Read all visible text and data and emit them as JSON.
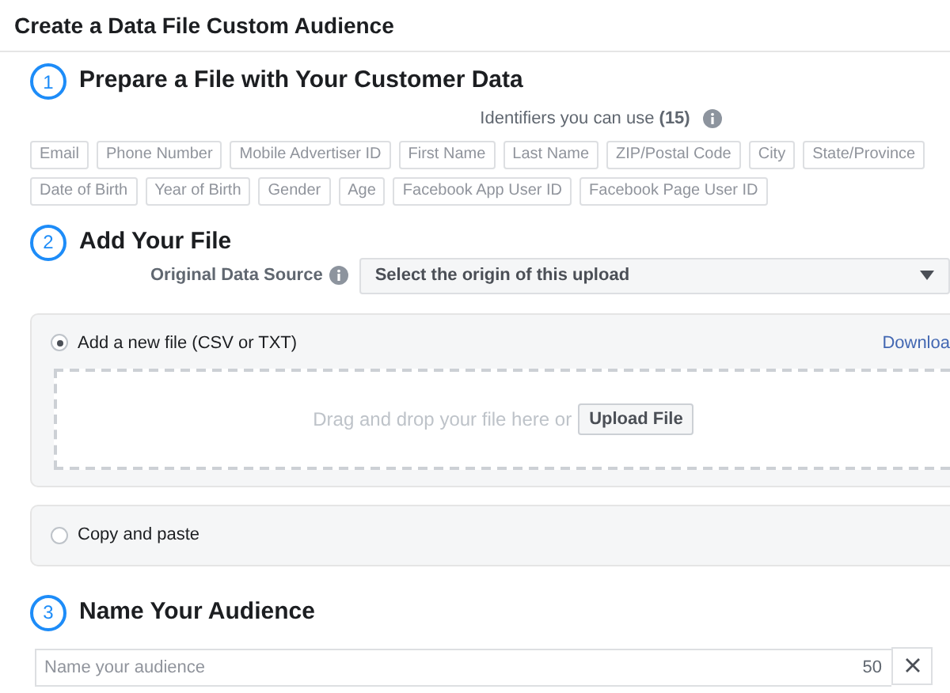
{
  "title": "Create a Data File Custom Audience",
  "step1": {
    "number": "1",
    "heading": "Prepare a File with Your Customer Data",
    "identifiers_label": "Identifiers you can use **(15)**",
    "identifier_rows": [
      [
        "Email",
        "Phone Number",
        "Mobile Advertiser ID",
        "First Name",
        "Last Name",
        "ZIP/Postal Code",
        "City",
        "State/Province"
      ],
      [
        "Date of Birth",
        "Year of Birth",
        "Gender",
        "Age",
        "Facebook App User ID",
        "Facebook Page User ID"
      ]
    ]
  },
  "step2": {
    "number": "2",
    "heading": "Add Your File",
    "source_label": "Original Data Source",
    "source_select": "Select the origin of this upload",
    "options": [
      {
        "label": "Add a new file (CSV or TXT)",
        "selected": true,
        "link": "Downloa",
        "drop_text": "Drag and drop your file here or",
        "upload_button": "Upload File"
      },
      {
        "label": "Copy and paste",
        "selected": false
      }
    ]
  },
  "step3": {
    "number": "3",
    "heading": "Name Your Audience",
    "name_field": {
      "placeholder": "Name your audience",
      "counter": "50"
    }
  }
}
